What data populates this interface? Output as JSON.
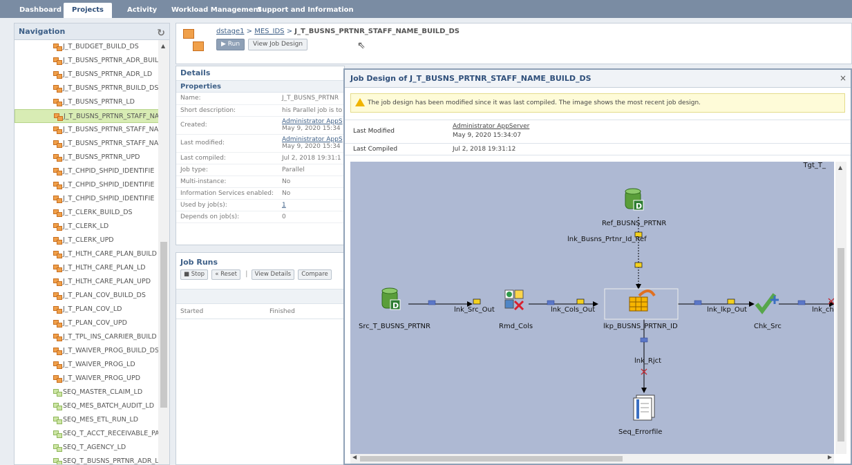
{
  "topnav": {
    "tabs": [
      "Dashboard",
      "Projects",
      "Activity",
      "Workload Management",
      "Support and Information"
    ]
  },
  "navigation": {
    "title": "Navigation",
    "items": [
      {
        "label": "J_T_BUDGET_BUILD_DS",
        "type": "job"
      },
      {
        "label": "J_T_BUSNS_PRTNR_ADR_BUIL",
        "type": "job"
      },
      {
        "label": "J_T_BUSNS_PRTNR_ADR_LD",
        "type": "job"
      },
      {
        "label": "J_T_BUSNS_PRTNR_BUILD_DS",
        "type": "job"
      },
      {
        "label": "J_T_BUSNS_PRTNR_LD",
        "type": "job"
      },
      {
        "label": "J_T_BUSNS_PRTNR_STAFF_NA",
        "type": "job",
        "selected": true
      },
      {
        "label": "J_T_BUSNS_PRTNR_STAFF_NA",
        "type": "job"
      },
      {
        "label": "J_T_BUSNS_PRTNR_STAFF_NA",
        "type": "job"
      },
      {
        "label": "J_T_BUSNS_PRTNR_UPD",
        "type": "job"
      },
      {
        "label": "J_T_CHPID_SHPID_IDENTIFIE",
        "type": "job"
      },
      {
        "label": "J_T_CHPID_SHPID_IDENTIFIE",
        "type": "job"
      },
      {
        "label": "J_T_CHPID_SHPID_IDENTIFIE",
        "type": "job"
      },
      {
        "label": "J_T_CLERK_BUILD_DS",
        "type": "job"
      },
      {
        "label": "J_T_CLERK_LD",
        "type": "job"
      },
      {
        "label": "J_T_CLERK_UPD",
        "type": "job"
      },
      {
        "label": "J_T_HLTH_CARE_PLAN_BUILD",
        "type": "job"
      },
      {
        "label": "J_T_HLTH_CARE_PLAN_LD",
        "type": "job"
      },
      {
        "label": "J_T_HLTH_CARE_PLAN_UPD",
        "type": "job"
      },
      {
        "label": "J_T_PLAN_COV_BUILD_DS",
        "type": "job"
      },
      {
        "label": "J_T_PLAN_COV_LD",
        "type": "job"
      },
      {
        "label": "J_T_PLAN_COV_UPD",
        "type": "job"
      },
      {
        "label": "J_T_TPL_INS_CARRIER_BUILD",
        "type": "job"
      },
      {
        "label": "J_T_WAIVER_PROG_BUILD_DS",
        "type": "job"
      },
      {
        "label": "J_T_WAIVER_PROG_LD",
        "type": "job"
      },
      {
        "label": "J_T_WAIVER_PROG_UPD",
        "type": "job"
      },
      {
        "label": "SEQ_MASTER_CLAIM_LD",
        "type": "seq"
      },
      {
        "label": "SEQ_MES_BATCH_AUDIT_LD",
        "type": "seq"
      },
      {
        "label": "SEQ_MES_ETL_RUN_LD",
        "type": "seq"
      },
      {
        "label": "SEQ_T_ACCT_RECEIVABLE_PA",
        "type": "seq"
      },
      {
        "label": "SEQ_T_AGENCY_LD",
        "type": "seq"
      },
      {
        "label": "SEQ_T_BUSNS_PRTNR_ADR_L",
        "type": "seq"
      }
    ]
  },
  "header": {
    "crumb1": "dstage1",
    "sep": " > ",
    "crumb2": "MES_IDS",
    "job": "J_T_BUSNS_PRTNR_STAFF_NAME_BUILD_DS",
    "run_label": "▶ Run",
    "view_design_label": "View Job Design"
  },
  "details": {
    "title": "Details",
    "properties_title": "Properties",
    "rows": [
      {
        "k": "Name:",
        "v": "J_T_BUSNS_PRTNR"
      },
      {
        "k": "Short description:",
        "v": "his Parallel job is to"
      },
      {
        "k": "Created:",
        "v": "Administrator AppS",
        "v2": "May 9, 2020 15:34"
      },
      {
        "k": "Last modified:",
        "v": "Administrator AppS",
        "v2": "May 9, 2020 15:34"
      },
      {
        "k": "Last compiled:",
        "v": "Jul 2, 2018 19:31:1"
      },
      {
        "k": "Job type:",
        "v": "Parallel"
      },
      {
        "k": "Multi-instance:",
        "v": "No"
      },
      {
        "k": "Information Services enabled:",
        "v": "No"
      },
      {
        "k": "Used by job(s):",
        "v": "1"
      },
      {
        "k": "Depends on job(s):",
        "v": "0"
      }
    ]
  },
  "jobruns": {
    "title": "Job Runs",
    "stop": "■ Stop",
    "reset": "« Reset",
    "sep": "|",
    "view_details": "View Details",
    "compare": "Compare",
    "col_started": "Started",
    "col_finished": "Finished"
  },
  "dialog": {
    "title": "Job Design of J_T_BUSNS_PRTNR_STAFF_NAME_BUILD_DS",
    "close": "×",
    "warning": "The job design has been modified since it was last compiled. The image shows the most recent job design.",
    "last_modified_label": "Last Modified",
    "last_modified_by": "Administrator AppServer",
    "last_modified_date": "May 9, 2020 15:34:07",
    "last_compiled_label": "Last Compiled",
    "last_compiled_date": "Jul 2, 2018 19:31:12"
  },
  "design": {
    "stages": {
      "src": "Src_T_BUSNS_PRTNR",
      "rmd": "Rmd_Cols",
      "lkp": "lkp_BUSNS_PRTNR_ID",
      "chk": "Chk_Src",
      "ref": "Ref_BUSNS_PRTNR",
      "err": "Seq_Errorfile",
      "tgt": "Tgt_T_"
    },
    "links": {
      "src_out": "lnk_Src_Out",
      "cols_out": "lnk_Cols_Out",
      "lkp_out": "lnk_lkp_Out",
      "ref": "lnk_Busns_Prtnr_Id_Ref",
      "rjct": "lnk_Rjct",
      "ch": "lnk_ch"
    }
  },
  "colors": {
    "canvas": "#aeb9d3",
    "selected": "#d8ecb4",
    "nav_bar": "#7a8ca3"
  }
}
